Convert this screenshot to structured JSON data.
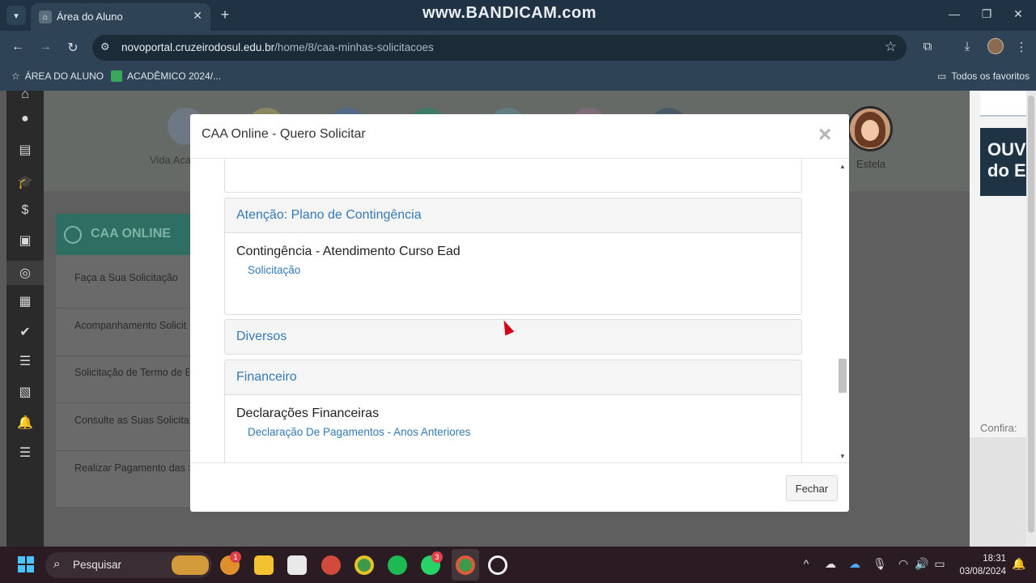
{
  "browser": {
    "tab_title": "Área do Aluno",
    "watermark": "www.BANDICAM.com",
    "url_host": "novoportal.cruzeirodosul.edu.br",
    "url_path": "/home/8/caa-minhas-solicitacoes",
    "bookmarks": [
      {
        "label": "ÁREA DO ALUNO"
      },
      {
        "label": "ACADÊMICO 2024/..."
      }
    ],
    "all_bookmarks_label": "Todos os favoritos"
  },
  "page": {
    "vida_label": "Vida Aca",
    "user_name": "Estela",
    "caa_title": "CAA ONLINE",
    "caa_menu": [
      {
        "label": "Faça a Sua Solicitação"
      },
      {
        "label": "Acompanhamento Solicit"
      },
      {
        "label": "Solicitação de Termo de E"
      },
      {
        "label": "Consulte as Suas Solicita"
      },
      {
        "label": "Realizar Pagamento das S"
      }
    ],
    "right_banner_line1": "OUV",
    "right_banner_line2": "do E",
    "confira_label": "Confira:"
  },
  "modal": {
    "title": "CAA Online - Quero Solicitar",
    "close_glyph": "×",
    "panels": [
      {
        "heading": "Atenção: Plano de Contingência",
        "service_title": "Contingência - Atendimento Curso Ead",
        "service_link": "Solicitação"
      },
      {
        "heading": "Diversos"
      },
      {
        "heading": "Financeiro",
        "service_title": "Declarações Financeiras",
        "service_link": "Declaração De Pagamentos - Anos Anteriores"
      }
    ],
    "close_button": "Fechar"
  },
  "taskbar": {
    "search_placeholder": "Pesquisar",
    "badge_1": "1",
    "badge_2": "3",
    "time": "18:31",
    "date": "03/08/2024"
  },
  "colors": {
    "link_blue": "#337ab7",
    "caa_green": "#2f6e62",
    "taskbar_bg": "#2a1c22",
    "chrome_bg": "#2e4355"
  }
}
